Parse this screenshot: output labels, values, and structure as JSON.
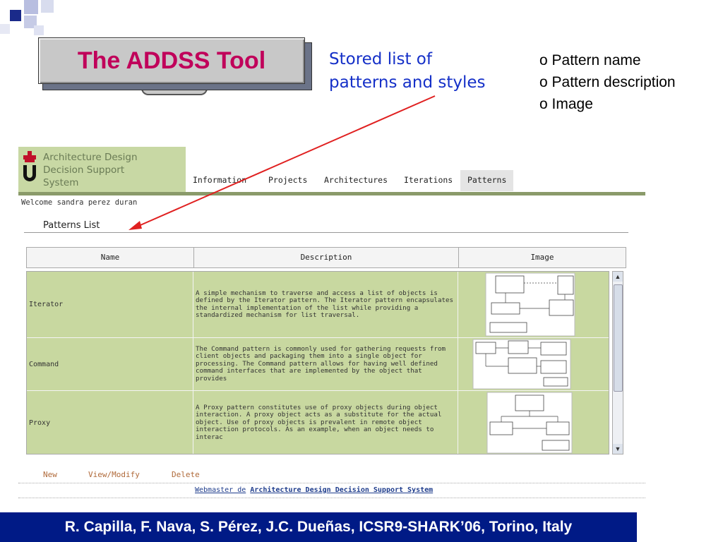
{
  "slide": {
    "title": "The ADDSS Tool",
    "stored_line1": "Stored list of",
    "stored_line2": "patterns and styles",
    "bullets": [
      "o Pattern name",
      "o Pattern description",
      "o Image"
    ],
    "credit": "R. Capilla, F. Nava, S. Pérez, J.C. Dueñas, ICSR9-SHARK’06, Torino, Italy"
  },
  "app": {
    "title_lines": [
      "Architecture Design",
      "Decision Support",
      "System"
    ],
    "nav": [
      "Information",
      "Projects",
      "Architectures",
      "Iterations",
      "Patterns"
    ],
    "active_nav": "Patterns",
    "welcome": "Welcome sandra perez duran",
    "section_title": "Patterns List",
    "columns": [
      "Name",
      "Description",
      "Image"
    ],
    "rows": [
      {
        "name": "Iterator",
        "description": "A simple mechanism to traverse and access a list of objects is defined by the Iterator pattern. The Iterator pattern encapsulates the internal implementation of the list while providing a standardized mechanism for list traversal."
      },
      {
        "name": "Command",
        "description": "The Command pattern is commonly used for gathering requests from client objects and packaging them into a single object for processing. The Command pattern allows for having well defined command interfaces that are implemented by the object that provides"
      },
      {
        "name": "Proxy",
        "description": "A Proxy pattern constitutes use of proxy objects during object interaction. A proxy object acts as a substitute for the actual object. Use of proxy objects is prevalent in remote object interaction protocols. As an example, when an object needs to interac"
      }
    ],
    "actions": [
      "New",
      "View/Modify",
      "Delete"
    ],
    "footer_prefix": "Webmaster de",
    "footer_link": "Architecture Design Decision Support System"
  },
  "colors": {
    "title_text": "#c0005a",
    "stored_text": "#1530c8",
    "credit_bg": "#001a86",
    "arrow": "#e02020",
    "table_green": "#c8d8a0"
  }
}
